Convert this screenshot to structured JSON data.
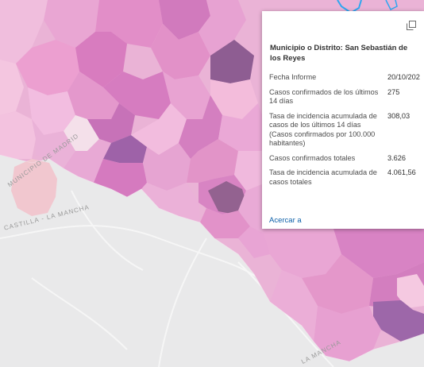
{
  "map": {
    "labels": {
      "madrid": "Municipio de Madrid",
      "castilla": "Castilla - La Mancha",
      "castilla_right": "La Mancha"
    },
    "colors": {
      "background": "#e9e9ea",
      "light_pink": "#f2c4dd",
      "medium_pink": "#e59bcc",
      "magenta": "#d474bf",
      "purple": "#9a66a6",
      "selection_outline": "#2ea7f0"
    }
  },
  "popup": {
    "title": "Municipio o Distrito: San Sebastián de los Reyes",
    "icons": {
      "maximize": "maximize-icon"
    },
    "fields": [
      {
        "label": "Fecha Informe",
        "value": "20/10/202"
      },
      {
        "label": "Casos confirmados de los últimos 14 días",
        "value": "275"
      },
      {
        "label": "Tasa de incidencia acumulada de casos de los últimos 14 días (Casos confirmados por 100.000 habitantes)",
        "value": "308,03"
      },
      {
        "label": "Casos confirmados totales",
        "value": "3.626"
      },
      {
        "label": "Tasa de incidencia acumulada de casos totales",
        "value": "4.061,56"
      }
    ],
    "zoom_link": "Acercar a"
  }
}
